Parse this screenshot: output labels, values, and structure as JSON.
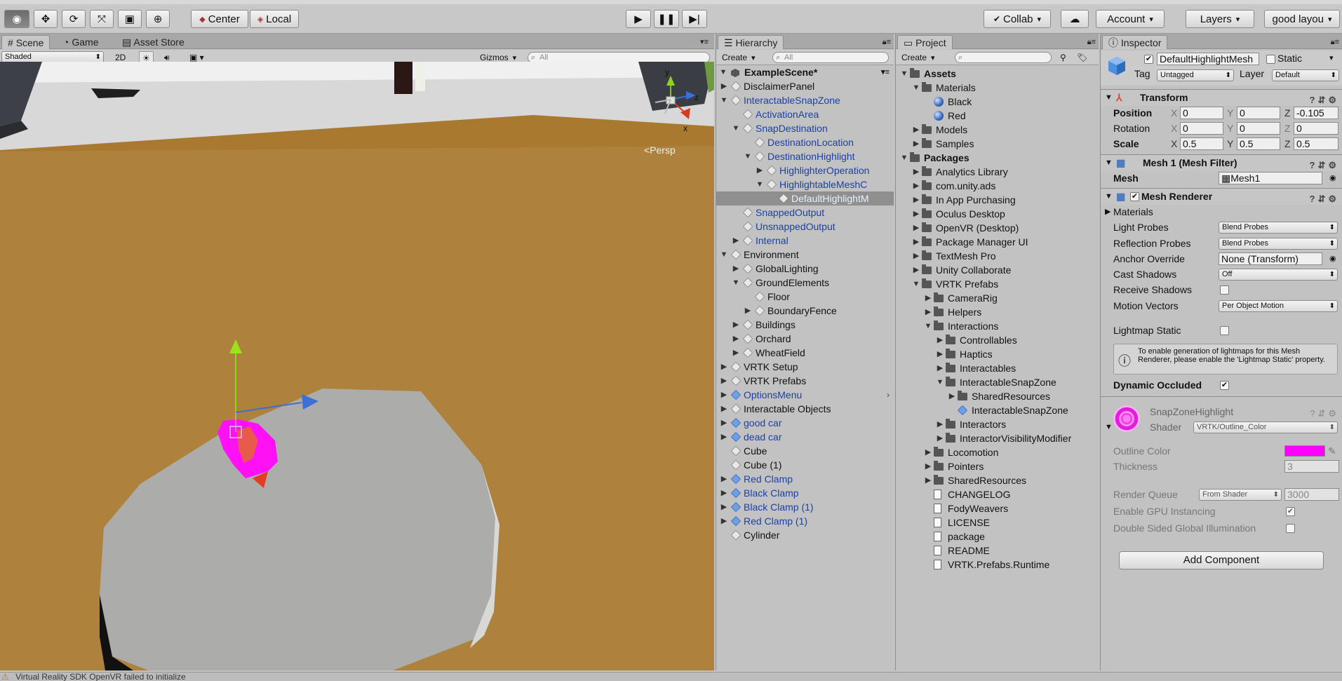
{
  "toolbar": {
    "pivot_label": "Center",
    "rotation_label": "Local",
    "collab_label": "Collab",
    "account_label": "Account",
    "layers_label": "Layers",
    "layout_label": "good layou"
  },
  "scene": {
    "tabs": [
      "Scene",
      "Game",
      "Asset Store"
    ],
    "shading_mode": "Shaded",
    "mode_2d_label": "2D",
    "gizmos_label": "Gizmos",
    "search_placeholder": "All",
    "persp_label": "Persp",
    "axis_y": "y",
    "axis_x": "x",
    "axis_z": "z"
  },
  "hierarchy": {
    "tab_label": "Hierarchy",
    "create_label": "Create",
    "search_placeholder": "All",
    "scene_name": "ExampleScene*",
    "items": [
      {
        "label": "DisclaimerPanel",
        "depth": 1,
        "arrow": "right",
        "prefab": false
      },
      {
        "label": "InteractableSnapZone",
        "depth": 1,
        "arrow": "down",
        "prefab": true
      },
      {
        "label": "ActivationArea",
        "depth": 2,
        "arrow": "",
        "prefab": true
      },
      {
        "label": "SnapDestination",
        "depth": 2,
        "arrow": "down",
        "prefab": true
      },
      {
        "label": "DestinationLocation",
        "depth": 3,
        "arrow": "",
        "prefab": true
      },
      {
        "label": "DestinationHighlight",
        "depth": 3,
        "arrow": "down",
        "prefab": true
      },
      {
        "label": "HighlighterOperation",
        "depth": 4,
        "arrow": "right",
        "prefab": true
      },
      {
        "label": "HighlightableMeshC",
        "depth": 4,
        "arrow": "down",
        "prefab": true
      },
      {
        "label": "DefaultHighlightM",
        "depth": 5,
        "arrow": "",
        "prefab": true,
        "selected": true
      },
      {
        "label": "SnappedOutput",
        "depth": 2,
        "arrow": "",
        "prefab": true
      },
      {
        "label": "UnsnappedOutput",
        "depth": 2,
        "arrow": "",
        "prefab": true
      },
      {
        "label": "Internal",
        "depth": 2,
        "arrow": "right",
        "prefab": true
      },
      {
        "label": "Environment",
        "depth": 1,
        "arrow": "down",
        "prefab": false
      },
      {
        "label": "GlobalLighting",
        "depth": 2,
        "arrow": "right",
        "prefab": false
      },
      {
        "label": "GroundElements",
        "depth": 2,
        "arrow": "down",
        "prefab": false
      },
      {
        "label": "Floor",
        "depth": 3,
        "arrow": "",
        "prefab": false
      },
      {
        "label": "BoundaryFence",
        "depth": 3,
        "arrow": "right",
        "prefab": false
      },
      {
        "label": "Buildings",
        "depth": 2,
        "arrow": "right",
        "prefab": false
      },
      {
        "label": "Orchard",
        "depth": 2,
        "arrow": "right",
        "prefab": false
      },
      {
        "label": "WheatField",
        "depth": 2,
        "arrow": "right",
        "prefab": false
      },
      {
        "label": "VRTK Setup",
        "depth": 1,
        "arrow": "right",
        "prefab": false
      },
      {
        "label": "VRTK Prefabs",
        "depth": 1,
        "arrow": "right",
        "prefab": false
      },
      {
        "label": "OptionsMenu",
        "depth": 1,
        "arrow": "right",
        "prefab": true,
        "icon_prefab": true
      },
      {
        "label": "Interactable Objects",
        "depth": 1,
        "arrow": "right",
        "prefab": false
      },
      {
        "label": "good car",
        "depth": 1,
        "arrow": "right",
        "prefab": true,
        "icon_prefab": true
      },
      {
        "label": "dead car",
        "depth": 1,
        "arrow": "right",
        "prefab": true,
        "icon_prefab": true
      },
      {
        "label": "Cube",
        "depth": 1,
        "arrow": "",
        "prefab": false
      },
      {
        "label": "Cube (1)",
        "depth": 1,
        "arrow": "",
        "prefab": false
      },
      {
        "label": "Red Clamp",
        "depth": 1,
        "arrow": "right",
        "prefab": true,
        "icon_prefab": true
      },
      {
        "label": "Black Clamp",
        "depth": 1,
        "arrow": "right",
        "prefab": true,
        "icon_prefab": true
      },
      {
        "label": "Black Clamp (1)",
        "depth": 1,
        "arrow": "right",
        "prefab": true,
        "icon_prefab": true
      },
      {
        "label": "Red Clamp (1)",
        "depth": 1,
        "arrow": "right",
        "prefab": true,
        "icon_prefab": true
      },
      {
        "label": "Cylinder",
        "depth": 1,
        "arrow": "",
        "prefab": false
      }
    ]
  },
  "project": {
    "tab_label": "Project",
    "create_label": "Create",
    "items": [
      {
        "label": "Assets",
        "depth": 0,
        "arrow": "down",
        "icon": "folder",
        "bold": true
      },
      {
        "label": "Materials",
        "depth": 1,
        "arrow": "down",
        "icon": "folder"
      },
      {
        "label": "Black",
        "depth": 2,
        "arrow": "",
        "icon": "material"
      },
      {
        "label": "Red",
        "depth": 2,
        "arrow": "",
        "icon": "material"
      },
      {
        "label": "Models",
        "depth": 1,
        "arrow": "right",
        "icon": "folder"
      },
      {
        "label": "Samples",
        "depth": 1,
        "arrow": "right",
        "icon": "folder"
      },
      {
        "label": "Packages",
        "depth": 0,
        "arrow": "down",
        "icon": "folder",
        "bold": true
      },
      {
        "label": "Analytics Library",
        "depth": 1,
        "arrow": "right",
        "icon": "folder"
      },
      {
        "label": "com.unity.ads",
        "depth": 1,
        "arrow": "right",
        "icon": "folder"
      },
      {
        "label": "In App Purchasing",
        "depth": 1,
        "arrow": "right",
        "icon": "folder"
      },
      {
        "label": "Oculus Desktop",
        "depth": 1,
        "arrow": "right",
        "icon": "folder"
      },
      {
        "label": "OpenVR (Desktop)",
        "depth": 1,
        "arrow": "right",
        "icon": "folder"
      },
      {
        "label": "Package Manager UI",
        "depth": 1,
        "arrow": "right",
        "icon": "folder"
      },
      {
        "label": "TextMesh Pro",
        "depth": 1,
        "arrow": "right",
        "icon": "folder"
      },
      {
        "label": "Unity Collaborate",
        "depth": 1,
        "arrow": "right",
        "icon": "folder"
      },
      {
        "label": "VRTK Prefabs",
        "depth": 1,
        "arrow": "down",
        "icon": "folder"
      },
      {
        "label": "CameraRig",
        "depth": 2,
        "arrow": "right",
        "icon": "folder"
      },
      {
        "label": "Helpers",
        "depth": 2,
        "arrow": "right",
        "icon": "folder"
      },
      {
        "label": "Interactions",
        "depth": 2,
        "arrow": "down",
        "icon": "folder"
      },
      {
        "label": "Controllables",
        "depth": 3,
        "arrow": "right",
        "icon": "folder"
      },
      {
        "label": "Haptics",
        "depth": 3,
        "arrow": "right",
        "icon": "folder"
      },
      {
        "label": "Interactables",
        "depth": 3,
        "arrow": "right",
        "icon": "folder"
      },
      {
        "label": "InteractableSnapZone",
        "depth": 3,
        "arrow": "down",
        "icon": "folder"
      },
      {
        "label": "SharedResources",
        "depth": 4,
        "arrow": "right",
        "icon": "folder"
      },
      {
        "label": "InteractableSnapZone",
        "depth": 4,
        "arrow": "",
        "icon": "prefab"
      },
      {
        "label": "Interactors",
        "depth": 3,
        "arrow": "right",
        "icon": "folder"
      },
      {
        "label": "InteractorVisibilityModifier",
        "depth": 3,
        "arrow": "right",
        "icon": "folder"
      },
      {
        "label": "Locomotion",
        "depth": 2,
        "arrow": "right",
        "icon": "folder"
      },
      {
        "label": "Pointers",
        "depth": 2,
        "arrow": "right",
        "icon": "folder"
      },
      {
        "label": "SharedResources",
        "depth": 2,
        "arrow": "right",
        "icon": "folder"
      },
      {
        "label": "CHANGELOG",
        "depth": 2,
        "arrow": "",
        "icon": "doc"
      },
      {
        "label": "FodyWeavers",
        "depth": 2,
        "arrow": "",
        "icon": "doc"
      },
      {
        "label": "LICENSE",
        "depth": 2,
        "arrow": "",
        "icon": "doc"
      },
      {
        "label": "package",
        "depth": 2,
        "arrow": "",
        "icon": "doc"
      },
      {
        "label": "README",
        "depth": 2,
        "arrow": "",
        "icon": "doc"
      },
      {
        "label": "VRTK.Prefabs.Runtime",
        "depth": 2,
        "arrow": "",
        "icon": "doc"
      }
    ]
  },
  "inspector": {
    "tab_label": "Inspector",
    "object_name": "DefaultHighlightMesh",
    "static_label": "Static",
    "tag_label": "Tag",
    "tag_value": "Untagged",
    "layer_label": "Layer",
    "layer_value": "Default",
    "transform": {
      "title": "Transform",
      "position_label": "Position",
      "rotation_label": "Rotation",
      "scale_label": "Scale",
      "x": "X",
      "y": "Y",
      "z": "Z",
      "position": [
        "0",
        "0",
        "-0.105"
      ],
      "rotation": [
        "0",
        "0",
        "0"
      ],
      "scale": [
        "0.5",
        "0.5",
        "0.5"
      ]
    },
    "mesh_filter": {
      "title": "Mesh 1 (Mesh Filter)",
      "mesh_label": "Mesh",
      "mesh_value": "Mesh1"
    },
    "mesh_renderer": {
      "title": "Mesh Renderer",
      "materials_label": "Materials",
      "light_probes_label": "Light Probes",
      "light_probes_value": "Blend Probes",
      "reflection_probes_label": "Reflection Probes",
      "reflection_probes_value": "Blend Probes",
      "anchor_override_label": "Anchor Override",
      "anchor_override_value": "None (Transform)",
      "cast_shadows_label": "Cast Shadows",
      "cast_shadows_value": "Off",
      "receive_shadows_label": "Receive Shadows",
      "motion_vectors_label": "Motion Vectors",
      "motion_vectors_value": "Per Object Motion",
      "lightmap_static_label": "Lightmap Static",
      "help_text": "To enable generation of lightmaps for this Mesh Renderer, please enable the 'Lightmap Static' property.",
      "dynamic_occluded_label": "Dynamic Occluded"
    },
    "material": {
      "name": "SnapZoneHighlight",
      "shader_label": "Shader",
      "shader_value": "VRTK/Outline_Color",
      "outline_color_label": "Outline Color",
      "outline_color": "#ff00ff",
      "thickness_label": "Thickness",
      "thickness_value": "3",
      "render_queue_label": "Render Queue",
      "render_queue_mode": "From Shader",
      "render_queue_value": "3000",
      "gpu_instancing_label": "Enable GPU Instancing",
      "double_sided_label": "Double Sided Global Illumination"
    },
    "add_component_label": "Add Component"
  },
  "status": {
    "message": "Virtual Reality SDK OpenVR failed to initialize"
  }
}
